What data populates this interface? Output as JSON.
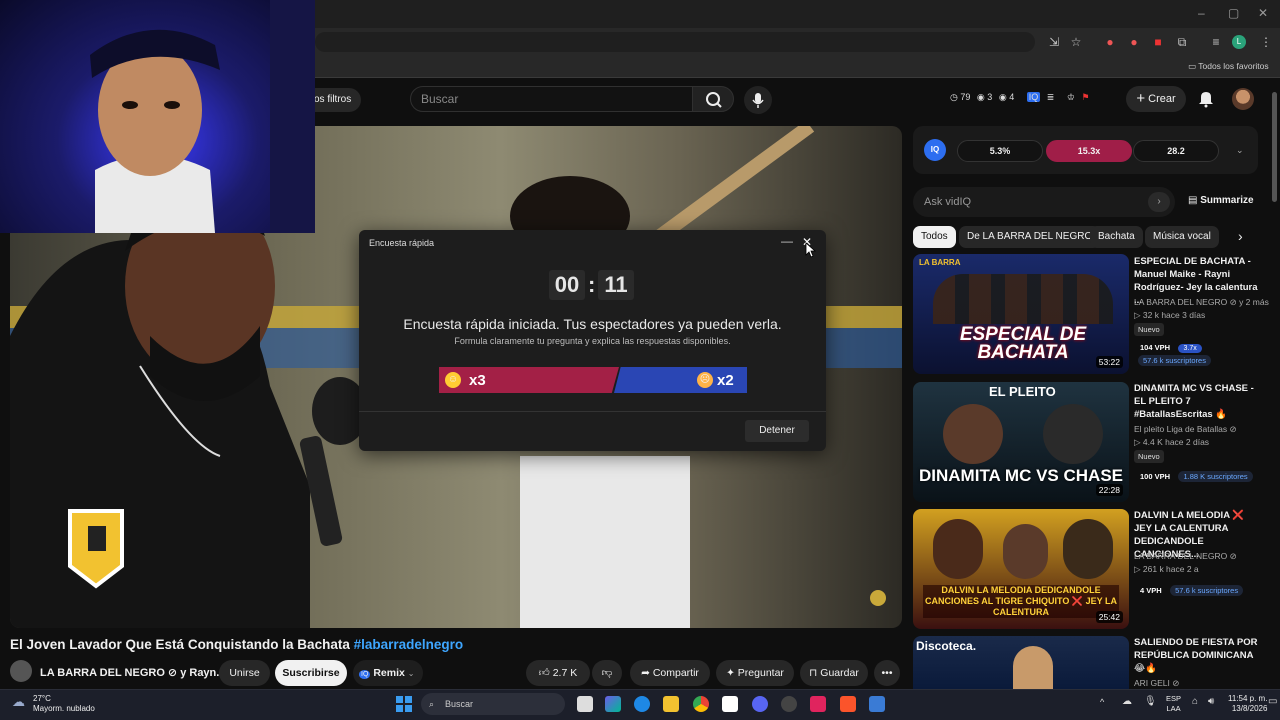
{
  "browser": {
    "window_controls": [
      "–",
      "▢",
      "✕"
    ],
    "bookmarks_label": "Todos los favoritos",
    "profile_initial": "L"
  },
  "yt_header": {
    "filters_label": "os filtros",
    "search_placeholder": "Buscar",
    "stats": {
      "a": "79",
      "b": "3",
      "c": "4"
    },
    "create_label": "Crear"
  },
  "poll": {
    "title": "Encuesta rápida",
    "timer_min": "00",
    "timer_sec": "11",
    "message": "Encuesta rápida iniciada. Tus espectadores ya pueden verla.",
    "hint": "Formula claramente tu pregunta y explica las respuestas disponibles.",
    "left_count": "x3",
    "right_count": "x2",
    "left_share": 0.6,
    "stop_label": "Detener"
  },
  "video": {
    "title": "El Joven Lavador Que Está Conquistando la Bachata",
    "hashtag": "#labarradelnegro",
    "channel": "LA BARRA DEL NEGRO ⊘ y Rayn...",
    "join_label": "Unirse",
    "subscribe_label": "Suscribirse",
    "remix_label": "Remix",
    "likes": "2.7 K",
    "share_label": "Compartir",
    "ask_label": "Preguntar",
    "save_label": "Guardar"
  },
  "vidiq": {
    "logo": "IQ",
    "metrics": [
      "5.3%",
      "15.3x",
      "28.2"
    ],
    "ask_placeholder": "Ask vidIQ",
    "summarize_label": "Summarize"
  },
  "chips": [
    "Todos",
    "De LA BARRA DEL NEGRO",
    "Bachata",
    "Música vocal"
  ],
  "related": [
    {
      "title": "ESPECIAL DE BACHATA - Manuel Maike - Rayni Rodríguez- Jey la calentura ...",
      "channel": "LA BARRA DEL NEGRO ⊘ y 2 más",
      "meta": "▷ 32 k  hace 3 días",
      "badge": "Nuevo",
      "vph": "104 VPH",
      "vph_x": "3.7x",
      "subs": "57.6 k suscriptores",
      "duration": "53:22",
      "thumb_text": "ESPECIAL DE BACHATA",
      "thumb_brand": "LA BARRA"
    },
    {
      "title": "DINAMITA MC VS CHASE - EL PLEITO 7 #BatallasEscritas 🔥",
      "channel": "El pleito Liga de Batallas ⊘",
      "meta": "▷ 4.4 K  hace 2 días",
      "badge": "Nuevo",
      "vph": "100 VPH",
      "vph_x": "",
      "subs": "1.88 K suscriptores",
      "duration": "22:28",
      "thumb_text": "DINAMITA MC VS CHASE",
      "thumb_brand": "EL PLEITO"
    },
    {
      "title": "DALVIN LA MELODIA ❌ JEY LA CALENTURA DEDICANDOLE CANCIONES...",
      "channel": "LA BARRA DEL NEGRO ⊘",
      "meta": "▷ 261 k  hace 2 a",
      "badge": "",
      "vph": "4 VPH",
      "vph_x": "",
      "subs": "57.6 k suscriptores",
      "duration": "25:42",
      "thumb_text": "DALVIN LA MELODIA DEDICANDOLE CANCIONES AL TIGRE CHIQUITO ❌ JEY LA CALENTURA",
      "thumb_brand": ""
    },
    {
      "title": "SALIENDO DE FIESTA POR REPÚBLICA DOMINICANA😂🔥",
      "channel": "ARI GELI ⊘",
      "meta": "",
      "badge": "",
      "vph": "",
      "vph_x": "",
      "subs": "",
      "duration": "",
      "thumb_text": "Discoteca.",
      "thumb_brand": ""
    }
  ],
  "taskbar": {
    "weather_temp": "27°C",
    "weather_desc": "Mayorm. nublado",
    "search_label": "Buscar",
    "lang_top": "ESP",
    "lang_bottom": "LAA",
    "time": "11:54 p. m.",
    "date": "13/8/2026"
  },
  "colors": {
    "poll_left": "#a32046",
    "poll_right": "#2a46b4",
    "link": "#3ea6ff",
    "vidiq_blue": "#2d6ef0"
  }
}
